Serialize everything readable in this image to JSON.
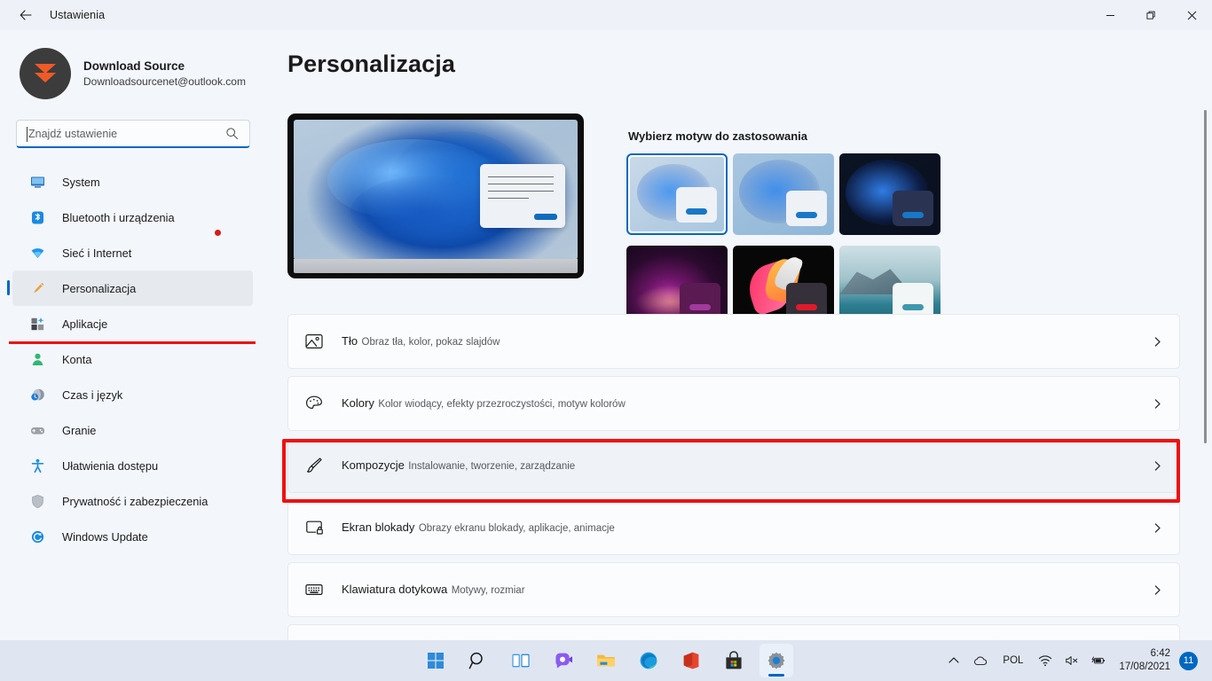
{
  "titlebar": {
    "back_icon": "back-arrow-icon",
    "title": "Ustawienia",
    "minimize_label": "minimize-icon",
    "restore_label": "restore-icon",
    "close_label": "close-icon"
  },
  "account": {
    "name": "Download Source",
    "email": "Downloadsourcenet@outlook.com"
  },
  "search": {
    "placeholder": "Znajdź ustawienie",
    "value": "",
    "icon": "search-icon"
  },
  "sidebar": {
    "items": [
      {
        "label": "System",
        "icon": "monitor-icon",
        "selected": false,
        "dot": false
      },
      {
        "label": "Bluetooth i urządzenia",
        "icon": "bluetooth-icon",
        "selected": false,
        "dot": false
      },
      {
        "label": "Sieć i Internet",
        "icon": "wifi-icon",
        "selected": false,
        "dot": true
      },
      {
        "label": "Personalizacja",
        "icon": "paintbrush-icon",
        "selected": true,
        "dot": false
      },
      {
        "label": "Aplikacje",
        "icon": "apps-icon",
        "selected": false,
        "dot": false
      },
      {
        "label": "Konta",
        "icon": "person-icon",
        "selected": false,
        "dot": false
      },
      {
        "label": "Czas i język",
        "icon": "clock-globe-icon",
        "selected": false,
        "dot": false
      },
      {
        "label": "Granie",
        "icon": "gamepad-icon",
        "selected": false,
        "dot": false
      },
      {
        "label": "Ułatwienia dostępu",
        "icon": "accessibility-icon",
        "selected": false,
        "dot": false
      },
      {
        "label": "Prywatność i zabezpieczenia",
        "icon": "shield-icon",
        "selected": false,
        "dot": false
      },
      {
        "label": "Windows Update",
        "icon": "update-icon",
        "selected": false,
        "dot": false
      }
    ]
  },
  "main": {
    "page_title": "Personalizacja",
    "theme_section_heading": "Wybierz motyw do zastosowania",
    "themes": [
      {
        "name": "theme-windows-light",
        "selected": true
      },
      {
        "name": "theme-windows-light-2",
        "selected": false
      },
      {
        "name": "theme-windows-dark",
        "selected": false
      },
      {
        "name": "theme-glow-dark",
        "selected": false
      },
      {
        "name": "theme-flow-dark",
        "selected": false
      },
      {
        "name": "theme-captured-motion-light",
        "selected": false
      }
    ],
    "settings": [
      {
        "title": "Tło",
        "subtitle": "Obraz tła, kolor, pokaz slajdów",
        "icon": "picture-icon",
        "highlighted": false
      },
      {
        "title": "Kolory",
        "subtitle": "Kolor wiodący, efekty przezroczystości, motyw kolorów",
        "icon": "palette-icon",
        "highlighted": false
      },
      {
        "title": "Kompozycje",
        "subtitle": "Instalowanie, tworzenie, zarządzanie",
        "icon": "paintbrush-icon",
        "highlighted": true
      },
      {
        "title": "Ekran blokady",
        "subtitle": "Obrazy ekranu blokady, aplikacje, animacje",
        "icon": "lockscreen-icon",
        "highlighted": false
      },
      {
        "title": "Klawiatura dotykowa",
        "subtitle": "Motywy, rozmiar",
        "icon": "keyboard-icon",
        "highlighted": false
      }
    ]
  },
  "taskbar": {
    "icons": [
      {
        "name": "start-icon",
        "active": false
      },
      {
        "name": "search-icon",
        "active": false
      },
      {
        "name": "task-view-icon",
        "active": false
      },
      {
        "name": "chat-icon",
        "active": false
      },
      {
        "name": "file-explorer-icon",
        "active": false
      },
      {
        "name": "edge-icon",
        "active": false
      },
      {
        "name": "office-icon",
        "active": false
      },
      {
        "name": "microsoft-store-icon",
        "active": false
      },
      {
        "name": "settings-icon",
        "active": true
      }
    ],
    "tray": {
      "chevron": "chevron-up-icon",
      "cloud": "onedrive-icon",
      "language": "POL",
      "wifi": "wifi-icon",
      "volume": "speaker-muted-icon",
      "battery": "battery-charging-icon",
      "time": "6:42",
      "date": "17/08/2021",
      "notification_count": "11"
    }
  },
  "colors": {
    "accent": "#0067c0",
    "highlight_red": "#ee1111",
    "window_bg": "#f3f6fb",
    "taskbar_bg": "#dfe6f2"
  }
}
